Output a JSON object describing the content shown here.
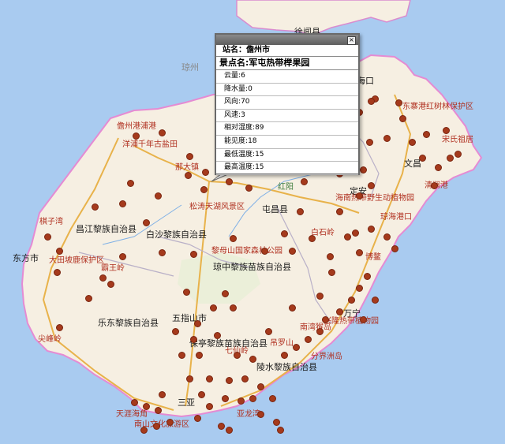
{
  "popup": {
    "station_label": "站名：",
    "station_value": "儋州市",
    "spot_label": "景点名:",
    "spot_value": "军屯热带榉果园",
    "rows": [
      {
        "label": "云量",
        "value": "6"
      },
      {
        "label": "降水量",
        "value": "0"
      },
      {
        "label": "风向",
        "value": "70"
      },
      {
        "label": "风速",
        "value": "3"
      },
      {
        "label": "相对湿度",
        "value": "89"
      },
      {
        "label": "能见度",
        "value": "18"
      },
      {
        "label": "最低温度",
        "value": "15"
      },
      {
        "label": "最高温度",
        "value": "15"
      }
    ],
    "close_glyph": "×"
  },
  "labels": {
    "xuwen": "徐闻县",
    "qiongzhou": "琼州",
    "danzhou_port": "儋州港浦港",
    "yangpu": "洋浦千年古盐田",
    "naban": "那大镇",
    "songtao": "松涛天湖风景区",
    "tunchang": "屯昌县",
    "dongfang": "东方市",
    "baisha": "白沙黎族自治县",
    "changjiang": "昌江黎族自治县",
    "qiongzhong": "琼中黎族苗族自治县",
    "wuzhishan": "五指山市",
    "ledong": "乐东黎族自治县",
    "baoting": "保亭黎族苗族自治县",
    "lingshui": "陵水黎族自治县",
    "sanya": "三亚",
    "wanning": "万宁",
    "qionghai": "琼海港口",
    "wenchang": "文昌",
    "haikou": "海口",
    "dingan": "定安",
    "qizi": "棋子湾",
    "jianfengling": "尖峰岭",
    "dongzhai": "东寨港红树林保护区",
    "songchang": "宋氏祖居",
    "qinglan": "清澜港",
    "hongyang": "红阳",
    "bawangling": "霸王岭",
    "diaoluo": "吊罗山",
    "qixianling": "七仙岭",
    "fenjie": "分界洲岛",
    "nanwan": "南湾猴岛",
    "yalong": "亚龙湾",
    "tianya": "天涯海角",
    "nanshan": "南山文化旅游区",
    "datian": "大田坡鹿保护区",
    "limu": "黎母山国家森林公园",
    "xinglong": "兴隆热带植物园",
    "baishi": "白石岭",
    "boao": "博鳌",
    "hainan_tropical": "海南热带野生动植物园"
  }
}
